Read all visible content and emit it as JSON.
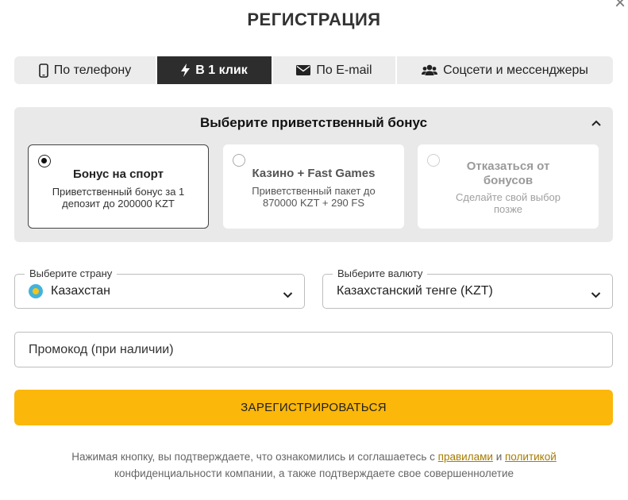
{
  "modal": {
    "title": "РЕГИСТРАЦИЯ",
    "close_glyph": "×"
  },
  "tabs": [
    {
      "label": "По телефону",
      "icon": "phone-icon",
      "active": false
    },
    {
      "label": "В 1 клик",
      "icon": "lightning-icon",
      "active": true
    },
    {
      "label": "По E-mail",
      "icon": "envelope-icon",
      "active": false
    },
    {
      "label": "Соцсети и мессенджеры",
      "icon": "users-icon",
      "active": false
    }
  ],
  "bonus": {
    "title": "Выберите приветственный бонус",
    "options": [
      {
        "name": "Бонус на спорт",
        "desc": "Приветственный бонус за 1 депозит до 200000 KZT",
        "selected": true
      },
      {
        "name": "Казино + Fast Games",
        "desc": "Приветственный пакет до 870000 KZT + 290 FS",
        "selected": false
      },
      {
        "name": "Отказаться от бонусов",
        "desc": "Сделайте свой выбор позже",
        "selected": false
      }
    ]
  },
  "country": {
    "label": "Выберите страну",
    "value": "Казахстан",
    "flag": "kazakhstan-flag-icon"
  },
  "currency": {
    "label": "Выберите валюту",
    "value": "Казахстанский тенге (KZT)"
  },
  "promo": {
    "placeholder": "Промокод (при наличии)",
    "value": ""
  },
  "register": {
    "label": "ЗАРЕГИСТРИРОВАТЬСЯ"
  },
  "consent": {
    "prefix": "Нажимая кнопку, вы подтверждаете, что ознакомились и соглашаетесь с",
    "rules_link": "правилами",
    "and": "и",
    "policy_link": "политикой",
    "suffix": "конфиденциальности компании, а также подтверждаете свое совершеннолетие"
  },
  "colors": {
    "accent": "#fbb70a",
    "active_tab": "#2d2d2d",
    "panel": "#e9e9e9",
    "link": "#a67c00"
  }
}
